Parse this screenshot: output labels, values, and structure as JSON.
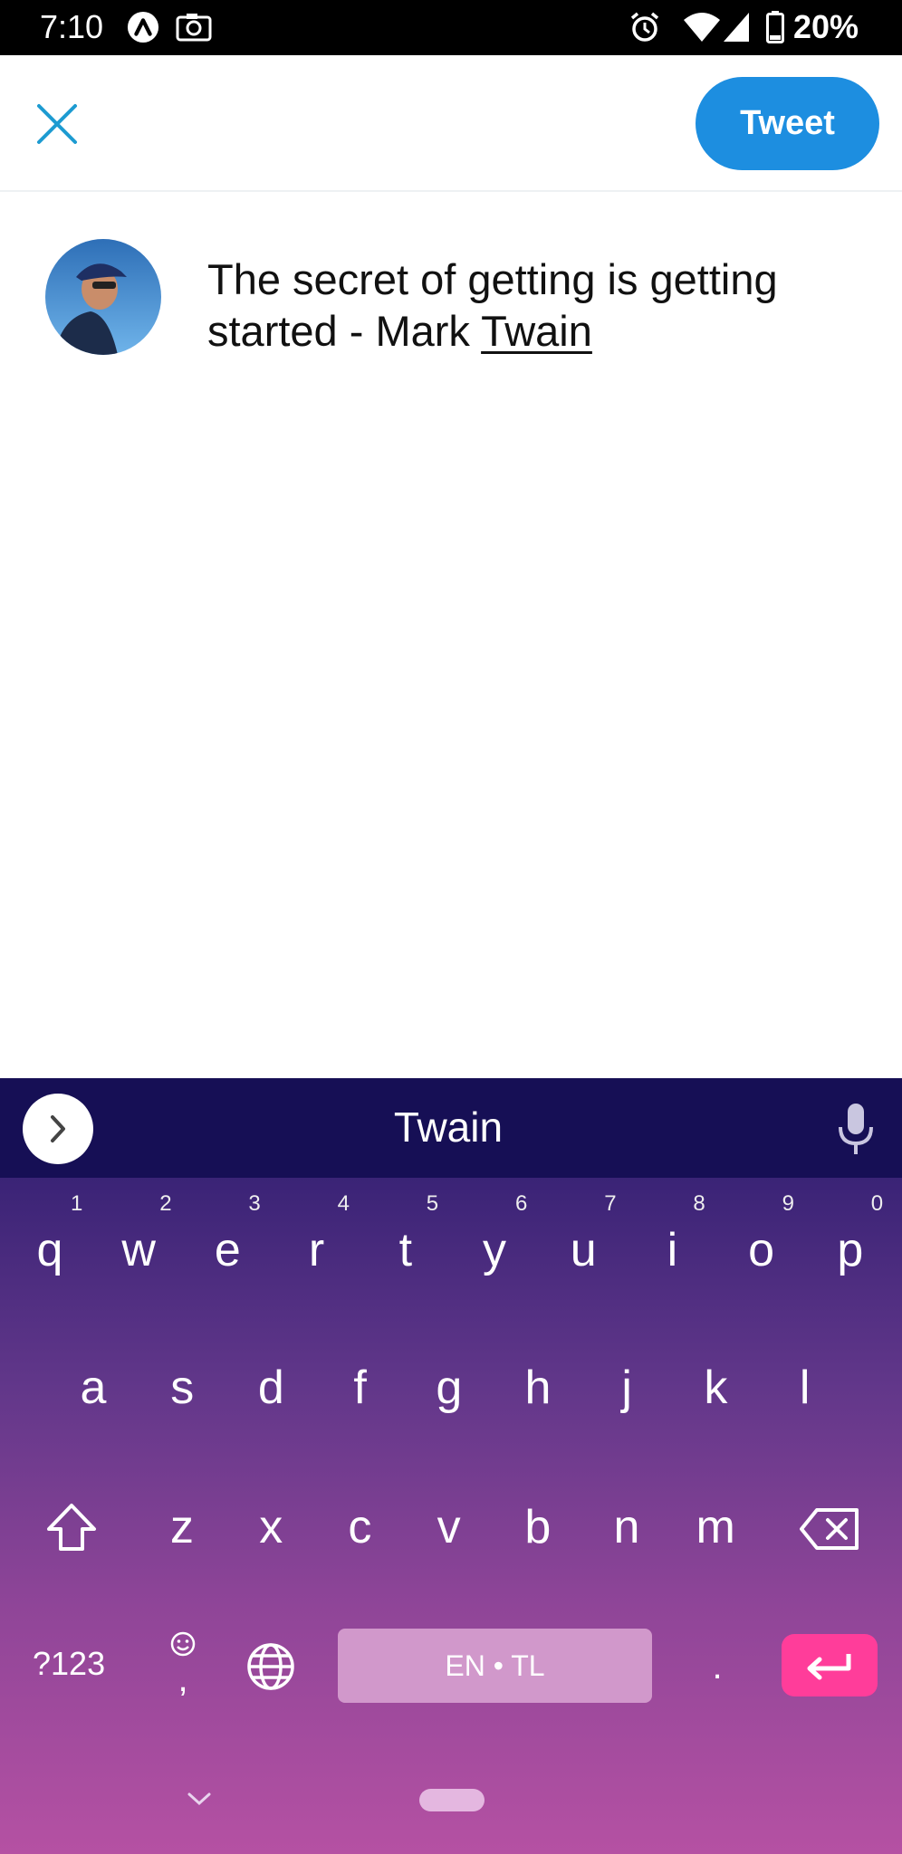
{
  "status_bar": {
    "time": "7:10",
    "battery_percent": "20%",
    "icons": [
      "assistant-a-icon",
      "screenshot-camera-icon",
      "alarm-icon",
      "wifi-icon",
      "signal-icon",
      "battery-icon"
    ]
  },
  "app_bar": {
    "close_icon": "close-x-icon",
    "tweet_label": "Tweet"
  },
  "composer": {
    "text_plain": "The secret of getting is getting started - Mark ",
    "text_underlined": "Twain"
  },
  "keyboard": {
    "suggestion": "Twain",
    "row1": [
      {
        "k": "q",
        "n": "1"
      },
      {
        "k": "w",
        "n": "2"
      },
      {
        "k": "e",
        "n": "3"
      },
      {
        "k": "r",
        "n": "4"
      },
      {
        "k": "t",
        "n": "5"
      },
      {
        "k": "y",
        "n": "6"
      },
      {
        "k": "u",
        "n": "7"
      },
      {
        "k": "i",
        "n": "8"
      },
      {
        "k": "o",
        "n": "9"
      },
      {
        "k": "p",
        "n": "0"
      }
    ],
    "row2": [
      "a",
      "s",
      "d",
      "f",
      "g",
      "h",
      "j",
      "k",
      "l"
    ],
    "row3": [
      "z",
      "x",
      "c",
      "v",
      "b",
      "n",
      "m"
    ],
    "symbols_label": "?123",
    "comma": ",",
    "space_label": "EN • TL",
    "period": ".",
    "colors": {
      "suggestion_bar": "#160f55",
      "enter_key": "#ff3d9a",
      "tweet_button": "#1d8ee0"
    }
  }
}
